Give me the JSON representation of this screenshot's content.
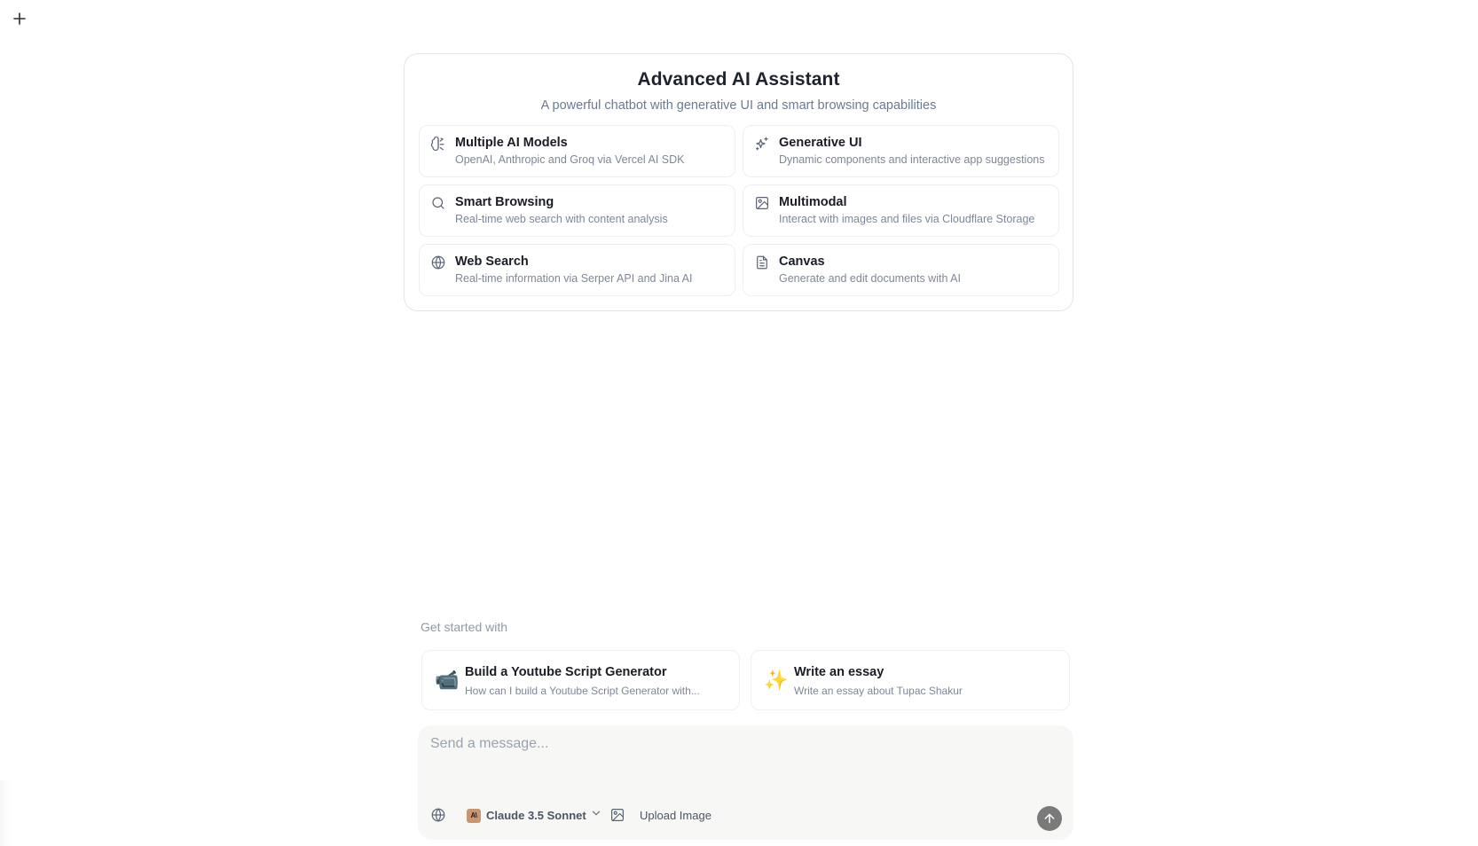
{
  "header": {
    "new_chat_icon": "plus-icon"
  },
  "hero": {
    "title": "Advanced AI Assistant",
    "subtitle": "A powerful chatbot with generative UI and smart browsing capabilities",
    "features": [
      {
        "icon": "brain-icon",
        "title": "Multiple AI Models",
        "description": "OpenAI, Anthropic and Groq via Vercel AI SDK"
      },
      {
        "icon": "sparkles-icon",
        "title": "Generative UI",
        "description": "Dynamic components and interactive app suggestions"
      },
      {
        "icon": "search-icon",
        "title": "Smart Browsing",
        "description": "Real-time web search with content analysis"
      },
      {
        "icon": "image-icon",
        "title": "Multimodal",
        "description": "Interact with images and files via Cloudflare Storage"
      },
      {
        "icon": "globe-icon",
        "title": "Web Search",
        "description": "Real-time information via Serper API and Jina AI"
      },
      {
        "icon": "document-icon",
        "title": "Canvas",
        "description": "Generate and edit documents with AI"
      }
    ]
  },
  "suggestions": {
    "heading": "Get started with",
    "items": [
      {
        "emoji": "📹",
        "title": "Build a Youtube Script Generator",
        "description": "How can I build a Youtube Script Generator with..."
      },
      {
        "emoji": "✨",
        "title": "Write an essay",
        "description": "Write an essay about Tupac Shakur"
      }
    ]
  },
  "composer": {
    "placeholder": "Send a message...",
    "value": "",
    "model": {
      "logo_text": "A\\",
      "label": "Claude 3.5 Sonnet"
    },
    "upload_label": "Upload Image"
  },
  "colors": {
    "model_logo_bg": "#c99673",
    "send_button_bg": "#7a7a7a",
    "composer_bg": "#f7f7f6"
  }
}
